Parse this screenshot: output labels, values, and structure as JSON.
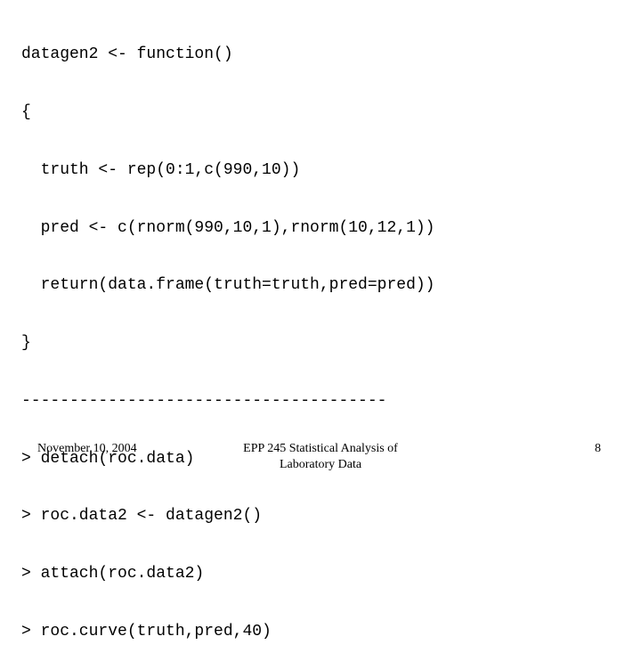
{
  "code": {
    "lines": [
      "datagen2 <- function()",
      "{",
      "  truth <- rep(0:1,c(990,10))",
      "  pred <- c(rnorm(990,10,1),rnorm(10,12,1))",
      "  return(data.frame(truth=truth,pred=pred))",
      "}",
      "--------------------------------------",
      "> detach(roc.data)",
      "> roc.data2 <- datagen2()",
      "> attach(roc.data2)",
      "> roc.curve(truth,pred,40)"
    ]
  },
  "footer": {
    "date": "November 10, 2004",
    "title_line1": "EPP 245 Statistical Analysis of",
    "title_line2": "Laboratory Data",
    "page_number": "8"
  }
}
